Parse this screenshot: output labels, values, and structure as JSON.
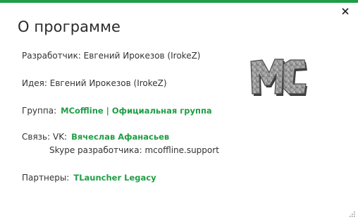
{
  "window": {
    "title": "О программе",
    "accent_color": "#1f9e45"
  },
  "developer": {
    "text": "Разработчик: Евгений Ирокезов (IrokeZ)"
  },
  "idea": {
    "text": "Идея: Евгений Ирокезов (IrokeZ)"
  },
  "group": {
    "label": "Группа:",
    "link": "MCoffline | Официальная группа"
  },
  "contact": {
    "label": "Связь: VK:",
    "link": "Вячеслав Афанасьев",
    "skype": "Skype разработчика: mcoffline.support"
  },
  "partners": {
    "label": "Партнеры:",
    "link": "TLauncher Legacy"
  },
  "logo": {
    "text": "MC",
    "icon": "mc-stone-logo"
  },
  "icons": {
    "close": "close-icon",
    "resize": "resize-grip-icon"
  }
}
